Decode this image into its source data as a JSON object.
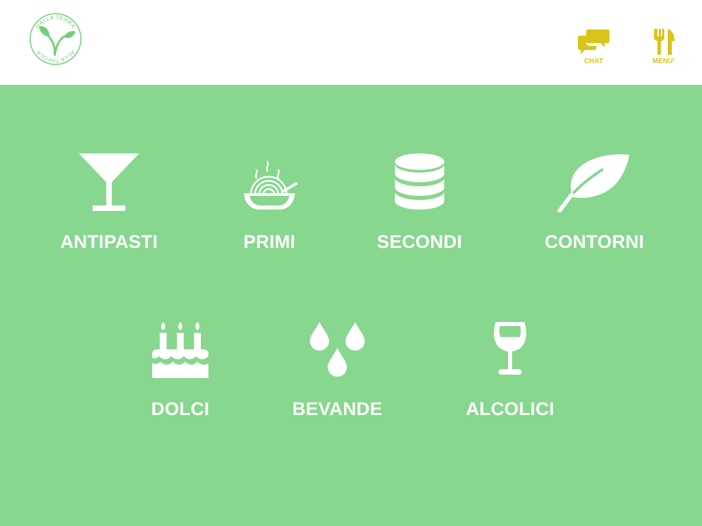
{
  "brand": {
    "logo_top_text": "DALLA TERRA",
    "logo_bottom_text": "ALLA TAVOLA"
  },
  "header": {
    "chat_label": "CHAT",
    "menu_label": "MENU'"
  },
  "colors": {
    "background_green": "#87d78e",
    "accent_yellow": "#d9c41a",
    "icon_white": "#ffffff",
    "logo_green": "#6fd07a"
  },
  "categories": [
    {
      "label": "ANTIPASTI",
      "icon": "cocktail-glass-icon"
    },
    {
      "label": "PRIMI",
      "icon": "pasta-bowl-icon"
    },
    {
      "label": "SECONDI",
      "icon": "database-stack-icon"
    },
    {
      "label": "CONTORNI",
      "icon": "leaf-icon"
    },
    {
      "label": "DOLCI",
      "icon": "birthday-cake-icon"
    },
    {
      "label": "BEVANDE",
      "icon": "water-drops-icon"
    },
    {
      "label": "ALCOLICI",
      "icon": "wine-glass-icon"
    }
  ]
}
